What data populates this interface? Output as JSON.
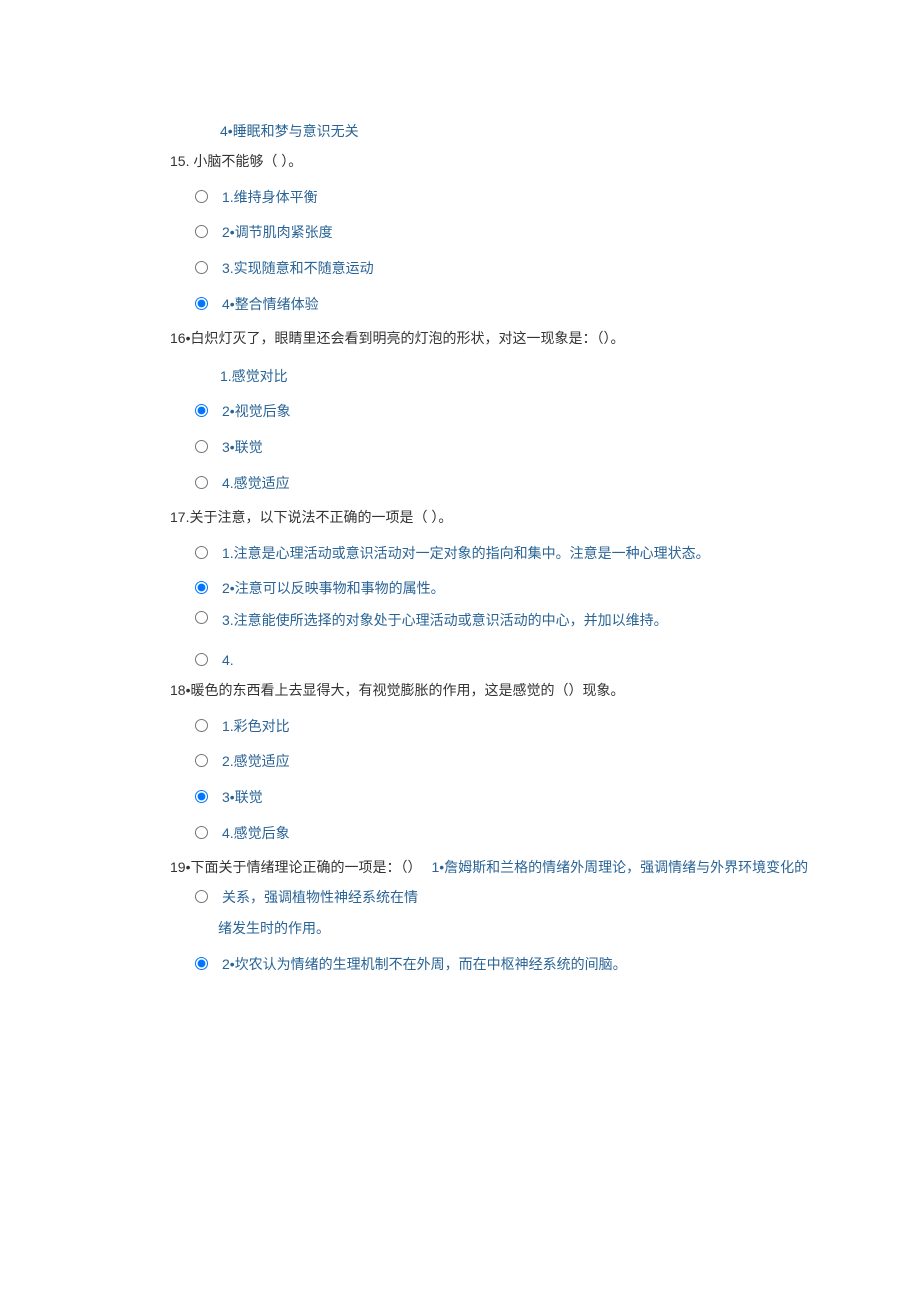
{
  "q14_opt4": "4•睡眠和梦与意识无关",
  "q15": {
    "text": "15.  小脑不能够（  ）。",
    "opts": [
      "1.维持身体平衡",
      "2•调节肌肉紧张度",
      "3.实现随意和不随意运动",
      "4•整合情绪体验"
    ]
  },
  "q16": {
    "text": "16•白炽灯灭了，眼睛里还会看到明亮的灯泡的形状，对这一现象是：（）。",
    "opts": [
      "1.感觉对比",
      "2•视觉后象",
      "3•联觉",
      "4.感觉适应"
    ]
  },
  "q17": {
    "text": "17.关于注意，以下说法不正确的一项是（  ）。",
    "opts": [
      "1.注意是心理活动或意识活动对一定对象的指向和集中。注意是一种心理状态。",
      "2•注意可以反映事物和事物的属性。",
      "3.注意能使所选择的对象处于心理活动或意识活动的中心，并加以维持。",
      "4."
    ]
  },
  "q18": {
    "text": "18•暖色的东西看上去显得大，有视觉膨胀的作用，这是感觉的（）现象。",
    "opts": [
      "1.彩色对比",
      "2.感觉适应",
      "3•联觉",
      "4.感觉后象"
    ]
  },
  "q19": {
    "prefix": "19•下面关于情绪理论正确的一项是：（）",
    "opt1_a": "1•詹姆斯和兰格的情绪外周理论，强调情绪与外界环境变化的",
    "opt1_b": "关系，强调植物性神经系统在情",
    "opt1_c": "绪发生时的作用。",
    "opt2": "2•坎农认为情绪的生理机制不在外周，而在中枢神经系统的间脑。"
  }
}
